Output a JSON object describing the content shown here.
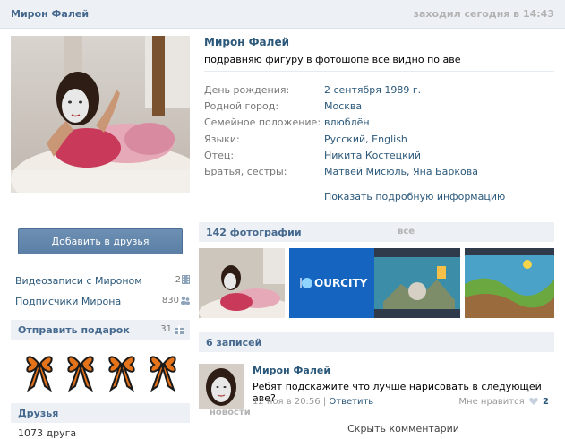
{
  "topbar": {
    "name": "Мирон Фалей",
    "last_seen": "заходил сегодня в 14:43"
  },
  "sidebar": {
    "add_friend_label": "Добавить в друзья",
    "videos": {
      "label": "Видеозаписи с Мироном",
      "count": "2"
    },
    "followers": {
      "label": "Подписчики Мирона",
      "count": "830"
    },
    "gifts": {
      "title": "Отправить подарок",
      "count": "31"
    },
    "friends": {
      "title": "Друзья",
      "news_link": "новости",
      "count_text": "1073 друга"
    }
  },
  "profile": {
    "name": "Мирон Фалей",
    "status": "подравняю фигуру в фотошопе всё видно по аве",
    "info": [
      {
        "key": "День рождения:",
        "value": "2 сентября 1989 г."
      },
      {
        "key": "Родной город:",
        "value": "Москва"
      },
      {
        "key": "Семейное положение:",
        "value": "влюблён"
      },
      {
        "key": "Языки:",
        "value": "Русский, English"
      },
      {
        "key": "Отец:",
        "value": "Никита Костецкий"
      },
      {
        "key": "Братья, сестры:",
        "value": "Матвей Мисюль, Яна Баркова"
      }
    ],
    "more_info_label": "Показать подробную информацию"
  },
  "photos": {
    "title": "142 фотографии",
    "all_link": "все",
    "thumb_logo_text": "OURCITY"
  },
  "wall": {
    "title": "6 записей",
    "post": {
      "author": "Мирон Фалей",
      "text": "Ребят подскажите что лучше нарисовать в следующей аве?",
      "date": "12 ноя в 20:56",
      "separator": "|",
      "reply_label": "Ответить",
      "like_label": "Мне нравится",
      "like_count": "2"
    },
    "show_comments_label": "Скрыть комментарии"
  }
}
